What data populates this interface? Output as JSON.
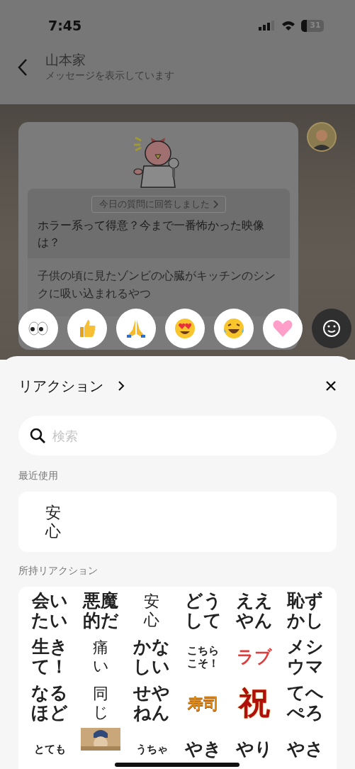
{
  "status_bar": {
    "time": "7:45",
    "battery": "31"
  },
  "header": {
    "title": "山本家",
    "subtitle": "メッセージを表示しています"
  },
  "message": {
    "badge": "今日の質問に回答しました",
    "question": "ホラー系って得意？今まで一番怖かった映像は？",
    "answer": "子供の頃に見たゾンビの心臓がキッチンのシンクに吸い込まれるやつ"
  },
  "quick_reactions": [
    {
      "kind": "eyes"
    },
    {
      "kind": "thumbs-up"
    },
    {
      "kind": "praying-hands"
    },
    {
      "kind": "heart-eyes"
    },
    {
      "kind": "laughing"
    },
    {
      "kind": "heart"
    }
  ],
  "sheet": {
    "title": "リアクション",
    "search": {
      "placeholder": "検索"
    },
    "recent_label": "最近使用",
    "recent": [
      {
        "kind": "serif",
        "lines": [
          "安",
          "心"
        ]
      }
    ],
    "owned_label": "所持リアクション",
    "owned": [
      {
        "kind": "bold",
        "lines": [
          "会い",
          "たい"
        ]
      },
      {
        "kind": "bold",
        "lines": [
          "悪魔",
          "的だ"
        ]
      },
      {
        "kind": "serif",
        "lines": [
          "安",
          "心"
        ]
      },
      {
        "kind": "bold",
        "lines": [
          "どう",
          "して"
        ]
      },
      {
        "kind": "bold",
        "lines": [
          "ええ",
          "やん"
        ]
      },
      {
        "kind": "bold",
        "lines": [
          "恥ず",
          "かし"
        ]
      },
      {
        "kind": "bold",
        "lines": [
          "生き",
          "て！"
        ]
      },
      {
        "kind": "serif",
        "lines": [
          "痛",
          "い"
        ]
      },
      {
        "kind": "bold",
        "lines": [
          "かな",
          "しい"
        ]
      },
      {
        "kind": "small",
        "lines": [
          "こちら",
          "こそ！"
        ]
      },
      {
        "kind": "red",
        "lines": [
          "ラブ"
        ]
      },
      {
        "kind": "bold",
        "lines": [
          "メシ",
          "ウマ"
        ]
      },
      {
        "kind": "bold",
        "lines": [
          "なる",
          "ほど"
        ]
      },
      {
        "kind": "serif",
        "lines": [
          "同",
          "じ"
        ]
      },
      {
        "kind": "bold",
        "lines": [
          "せや",
          "ねん"
        ]
      },
      {
        "kind": "gold",
        "lines": [
          "寿司"
        ]
      },
      {
        "kind": "festive",
        "lines": [
          "祝"
        ]
      },
      {
        "kind": "bold",
        "lines": [
          "てへ",
          "ぺろ"
        ]
      },
      {
        "kind": "small",
        "lines": [
          "とても"
        ]
      },
      {
        "kind": "picture"
      },
      {
        "kind": "small",
        "lines": [
          "うちゃ"
        ]
      },
      {
        "kind": "bold",
        "lines": [
          "やき"
        ]
      },
      {
        "kind": "bold",
        "lines": [
          "やり"
        ]
      },
      {
        "kind": "bold",
        "lines": [
          "やさ"
        ]
      }
    ]
  }
}
